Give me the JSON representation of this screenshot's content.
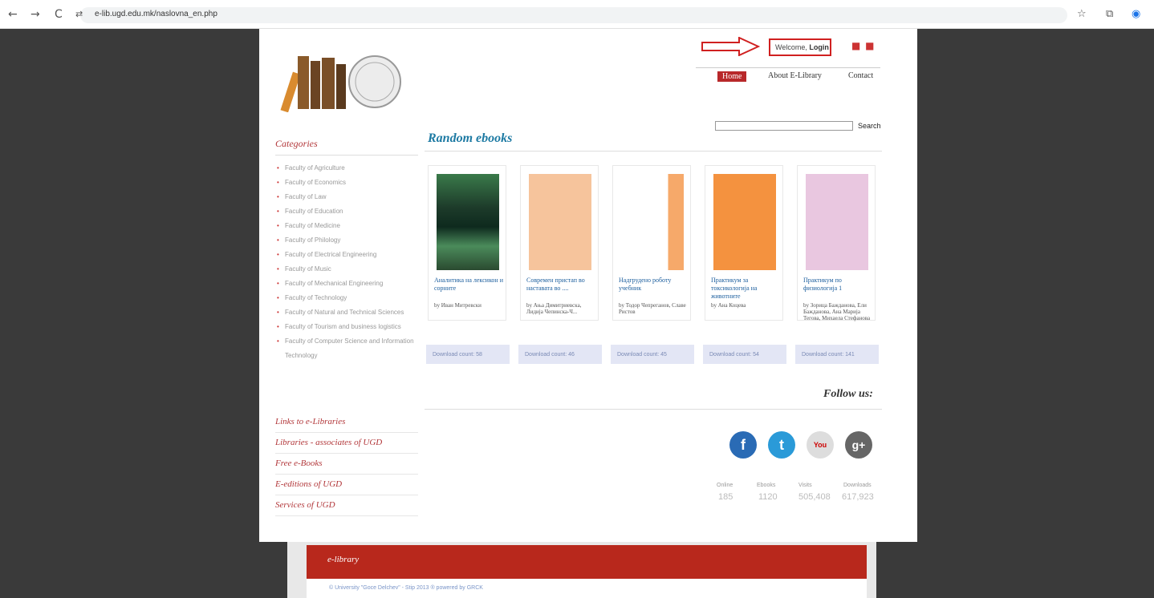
{
  "browser": {
    "url": "e-lib.ugd.edu.mk/naslovna_en.php",
    "back_icon": "←",
    "forward_icon": "→",
    "reload_icon": "C",
    "site_icon": "⇄",
    "star_icon": "☆",
    "ext_icon": "⧉",
    "profile_icon": "◉"
  },
  "header": {
    "welcome_prefix": "Welcome,",
    "login_label": "Login",
    "flags": "■ ■",
    "nav": [
      "Home",
      "About E-Library",
      "Contact"
    ]
  },
  "search": {
    "button_label": "Search"
  },
  "sidebar": {
    "categories_title": "Categories",
    "categories": [
      "Faculty of Agriculture",
      "Faculty of Economics",
      "Faculty of Law",
      "Faculty of Education",
      "Faculty of Medicine",
      "Faculty of Philology",
      "Faculty of Electrical Engineering",
      "Faculty of Music",
      "Faculty of Mechanical Engineering",
      "Faculty of Technology",
      "Faculty of Natural and Technical Sciences",
      "Faculty of Tourism and business logistics",
      "Faculty of Computer Science and Information Technology"
    ],
    "links": [
      "Links to e-Libraries",
      "Libraries - associates of UGD",
      "Free e-Books",
      "E-editions of UGD",
      "Services of UGD"
    ]
  },
  "main": {
    "section_title": "Random ebooks",
    "books": [
      {
        "title": "Аналитика на лексикон и сорните",
        "author": "by Иван Митревски",
        "download": "Download count: 58"
      },
      {
        "title": "Современ пристап во наставата во ....",
        "author": "by Ања Димитриевска, Лидија Чепинска-Ч...",
        "download": "Download count: 46"
      },
      {
        "title": "Надгрудено роботу учебник",
        "author": "by Тодор Чепреганов, Славе Ристов",
        "download": "Download count: 45"
      },
      {
        "title": "Практикум за токсикологија на животните",
        "author": "by Ана Коцева",
        "download": "Download count: 54"
      },
      {
        "title": "Практикум по физиологија 1",
        "author": "by Зорица Бажданова, Ели Бажданова, Ана Марија Тегова, Михаела Стефанова",
        "download": "Download count: 141"
      }
    ],
    "follow_title": "Follow us:",
    "social": [
      "f",
      "t",
      "You",
      "g+"
    ],
    "stats": [
      {
        "label": "Online",
        "value": "185"
      },
      {
        "label": "Ebooks",
        "value": "1120"
      },
      {
        "label": "Visits",
        "value": "505,408"
      },
      {
        "label": "Downloads",
        "value": "617,923"
      }
    ]
  },
  "footer": {
    "logo_text": "e-library",
    "text": "© University \"Goce Delchev\" - Stip 2013   ® powered by GRCK"
  }
}
